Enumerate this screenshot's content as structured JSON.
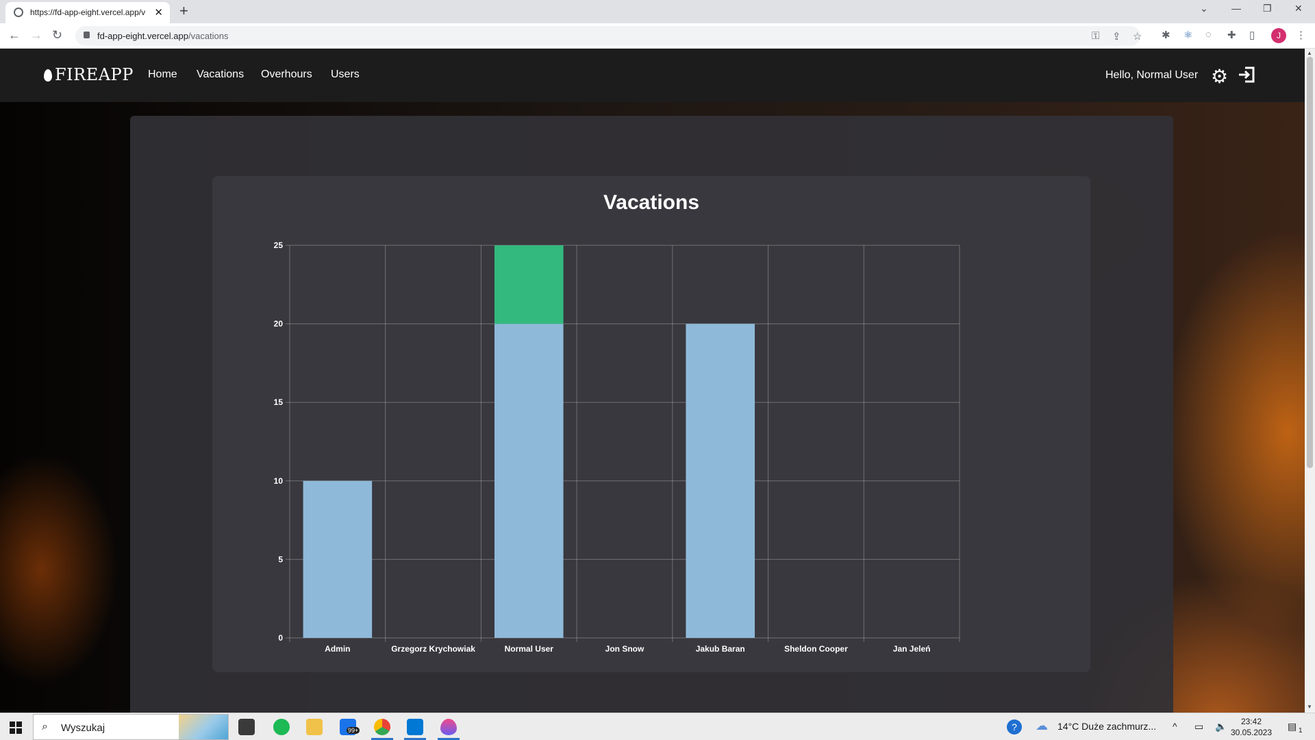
{
  "browser": {
    "tab_title": "https://fd-app-eight.vercel.app/v",
    "url_host": "fd-app-eight.vercel.app",
    "url_path": "/vacations",
    "profile_initial": "J"
  },
  "app": {
    "brand": "FIREAPP",
    "nav": [
      "Home",
      "Vacations",
      "Overhours",
      "Users"
    ],
    "greeting": "Hello, Normal User"
  },
  "chart_data": {
    "type": "bar",
    "stacked": true,
    "title": "Vacations",
    "categories": [
      "Admin",
      "Grzegorz Krychowiak",
      "Normal User",
      "Jon Snow",
      "Jakub Baran",
      "Sheldon Cooper",
      "Jan Jeleń"
    ],
    "series": [
      {
        "color": "#8fb9d9",
        "values": [
          10,
          0,
          20,
          0,
          20,
          0,
          0
        ]
      },
      {
        "color": "#33b97e",
        "values": [
          0,
          0,
          5,
          0,
          0,
          0,
          0
        ]
      }
    ],
    "yticks": [
      0,
      5,
      10,
      15,
      20,
      25
    ],
    "ylim": [
      0,
      25
    ],
    "grid": true
  },
  "taskbar": {
    "search_placeholder": "Wyszukaj",
    "mail_badge": "99+",
    "weather": "14°C  Duże zachmurz...",
    "time": "23:42",
    "date": "30.05.2023",
    "notifications": "1"
  }
}
